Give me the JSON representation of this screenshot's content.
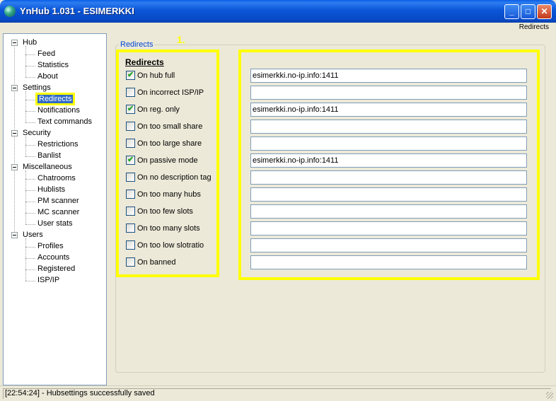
{
  "window": {
    "title": "YnHub 1.031 - ESIMERKKI"
  },
  "titlebar_buttons": {
    "minimize": "_",
    "maximize": "□",
    "close": "✕"
  },
  "top_status": "Redirects",
  "tree": [
    {
      "label": "Hub",
      "level": 0
    },
    {
      "label": "Feed",
      "level": 1
    },
    {
      "label": "Statistics",
      "level": 1
    },
    {
      "label": "About",
      "level": 1
    },
    {
      "label": "Settings",
      "level": 0
    },
    {
      "label": "Redirects",
      "level": 1,
      "selected": true
    },
    {
      "label": "Notifications",
      "level": 1
    },
    {
      "label": "Text commands",
      "level": 1
    },
    {
      "label": "Security",
      "level": 0
    },
    {
      "label": "Restrictions",
      "level": 1
    },
    {
      "label": "Banlist",
      "level": 1
    },
    {
      "label": "Miscellaneous",
      "level": 0
    },
    {
      "label": "Chatrooms",
      "level": 1
    },
    {
      "label": "Hublists",
      "level": 1
    },
    {
      "label": "PM scanner",
      "level": 1
    },
    {
      "label": "MC scanner",
      "level": 1
    },
    {
      "label": "User stats",
      "level": 1
    },
    {
      "label": "Users",
      "level": 0
    },
    {
      "label": "Profiles",
      "level": 1
    },
    {
      "label": "Accounts",
      "level": 1
    },
    {
      "label": "Registered",
      "level": 1
    },
    {
      "label": "ISP/IP",
      "level": 1
    }
  ],
  "panel": {
    "group_label": "Redirects",
    "heading": "Redirects",
    "annotation": "1."
  },
  "redirects": [
    {
      "label": "On hub full",
      "checked": true,
      "value": "esimerkki.no-ip.info:1411"
    },
    {
      "label": "On incorrect ISP/IP",
      "checked": false,
      "value": ""
    },
    {
      "label": "On reg. only",
      "checked": true,
      "value": "esimerkki.no-ip.info:1411"
    },
    {
      "label": "On too small share",
      "checked": false,
      "value": ""
    },
    {
      "label": "On too large share",
      "checked": false,
      "value": ""
    },
    {
      "label": "On passive mode",
      "checked": true,
      "value": "esimerkki.no-ip.info:1411"
    },
    {
      "label": "On no description tag",
      "checked": false,
      "value": ""
    },
    {
      "label": "On too many hubs",
      "checked": false,
      "value": ""
    },
    {
      "label": "On too few slots",
      "checked": false,
      "value": ""
    },
    {
      "label": "On too many slots",
      "checked": false,
      "value": ""
    },
    {
      "label": "On too low slotratio",
      "checked": false,
      "value": ""
    },
    {
      "label": "On banned",
      "checked": false,
      "value": ""
    }
  ],
  "status_bar": "[22:54:24] - Hubsettings successfully saved",
  "colors": {
    "highlight": "#ffff00",
    "selection": "#316ac5",
    "titlebar": "#0a56d8"
  }
}
